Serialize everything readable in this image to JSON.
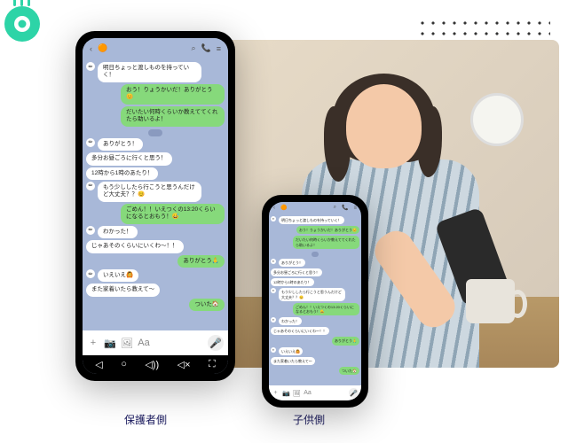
{
  "captions": {
    "parent": "保護者側",
    "child": "子供側"
  },
  "chat": {
    "header": {
      "title": " "
    },
    "date_separator": "",
    "messages": [
      {
        "side": "left",
        "text": "明日ちょっと渡しものを持っていく！"
      },
      {
        "side": "right",
        "text": "おう！りょうかいだ！ありがとう😊"
      },
      {
        "side": "right",
        "text": "だいたい何時くらいか教えててくれたら助いるよ！"
      },
      {
        "side": "left",
        "text": "ありがとう！"
      },
      {
        "side": "left",
        "text": "多分お昼ごろに行くと思う！"
      },
      {
        "side": "left",
        "text": "12時から1時のあたり！"
      },
      {
        "side": "left",
        "text": "もう少ししたら行こうと思うんだけど大丈夫？？😊"
      },
      {
        "side": "right",
        "text": "ごめん！！いえつくの13:20くらいになるとおもう！😅"
      },
      {
        "side": "left",
        "text": "わかった！"
      },
      {
        "side": "left",
        "text": "じゃあそのくらいにいくわ〜！！"
      },
      {
        "side": "right",
        "text": "ありがとう🙏"
      },
      {
        "side": "left",
        "text": "いえいえ🙆"
      },
      {
        "side": "left",
        "text": "また家着いたら教えて〜"
      },
      {
        "side": "right",
        "text": "ついた🏠"
      }
    ]
  }
}
